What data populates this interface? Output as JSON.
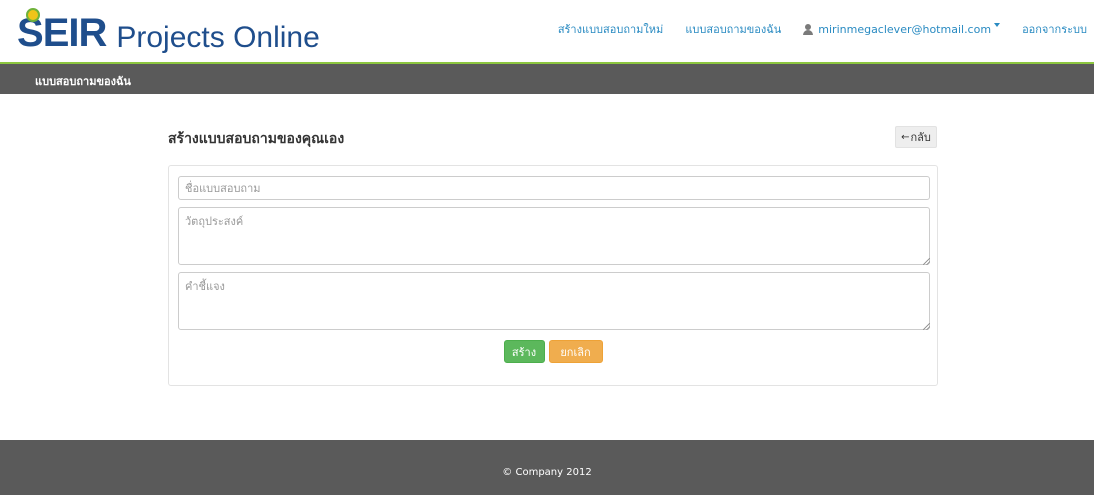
{
  "brand": {
    "logo_first_letter": "S",
    "logo_bold_rest": "EIR",
    "logo_rest": "Projects Online",
    "primary_color": "#1f4e8c",
    "accent_color": "#8cc63f"
  },
  "topnav": {
    "create_new": "สร้างแบบสอบถามใหม่",
    "my_surveys": "แบบสอบถามของฉัน",
    "user_email": "mirinmegaclever@hotmail.com",
    "logout": "ออกจากระบบ",
    "link_color": "#2a8bc2"
  },
  "subbar": {
    "title": "แบบสอบถามของฉัน"
  },
  "page": {
    "title": "สร้างแบบสอบถามของคุณเอง",
    "back_label": "กลับ"
  },
  "form": {
    "name_placeholder": "ชื่อแบบสอบถาม",
    "purpose_placeholder": "วัตถุประสงค์",
    "description_placeholder": "คำชี้แจง",
    "create_label": "สร้าง",
    "cancel_label": "ยกเลิก",
    "create_color": "#5cb85c",
    "cancel_color": "#f0ad4e"
  },
  "footer": {
    "copyright": "© Company 2012"
  },
  "icons": {
    "user": "user-icon",
    "back": "arrow-left-icon",
    "caret": "caret-down-icon"
  }
}
